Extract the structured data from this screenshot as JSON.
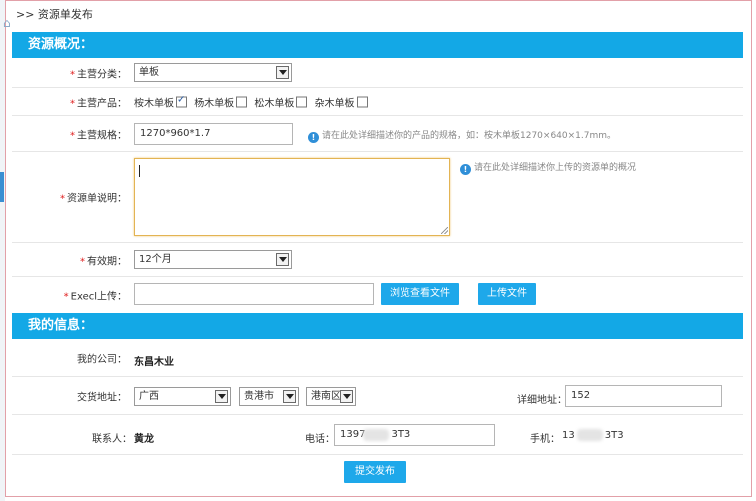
{
  "breadcrumb": {
    "home_icon": "home-icon",
    "text": ">> 资源单发布"
  },
  "overview": {
    "header": "资源概况：",
    "category": {
      "label": "主营分类：",
      "value": "单板"
    },
    "products": {
      "label": "主营产品：",
      "items": [
        {
          "label": "桉木单板",
          "checked": true
        },
        {
          "label": "杨木单板",
          "checked": false
        },
        {
          "label": "松木单板",
          "checked": false
        },
        {
          "label": "杂木单板",
          "checked": false
        }
      ]
    },
    "spec": {
      "label": "主营规格：",
      "value": "1270*960*1.7",
      "hint": "请在此处详细描述你的产品的规格，如：桉木单板1270×640×1.7mm。"
    },
    "description": {
      "label": "资源单说明：",
      "value": "",
      "hint": "请在此处详细描述你上传的资源单的概况"
    },
    "validity": {
      "label": "有效期：",
      "value": "12个月"
    },
    "excel": {
      "label": "Execl上传：",
      "value": "",
      "browse_label": "浏览查看文件",
      "upload_label": "上传文件"
    }
  },
  "my_info": {
    "header": "我的信息：",
    "company": {
      "label": "我的公司：",
      "value": "东昌木业"
    },
    "address": {
      "label": "交货地址：",
      "province": "广西",
      "city": "贵港市",
      "district": "港南区",
      "detail_label": "详细地址：",
      "detail_value": "152"
    },
    "contact": {
      "label": "联系人：",
      "value": "黄龙"
    },
    "phone": {
      "label": "电话：",
      "value_prefix": "1397",
      "value_suffix": "3T3"
    },
    "mobile": {
      "label": "手机：",
      "value_prefix": "13",
      "value_suffix": "3T3"
    },
    "submit_label": "提交发布"
  },
  "colors": {
    "accent": "#13a8e6",
    "required": "#e02020",
    "frame": "#e2a0a8"
  }
}
